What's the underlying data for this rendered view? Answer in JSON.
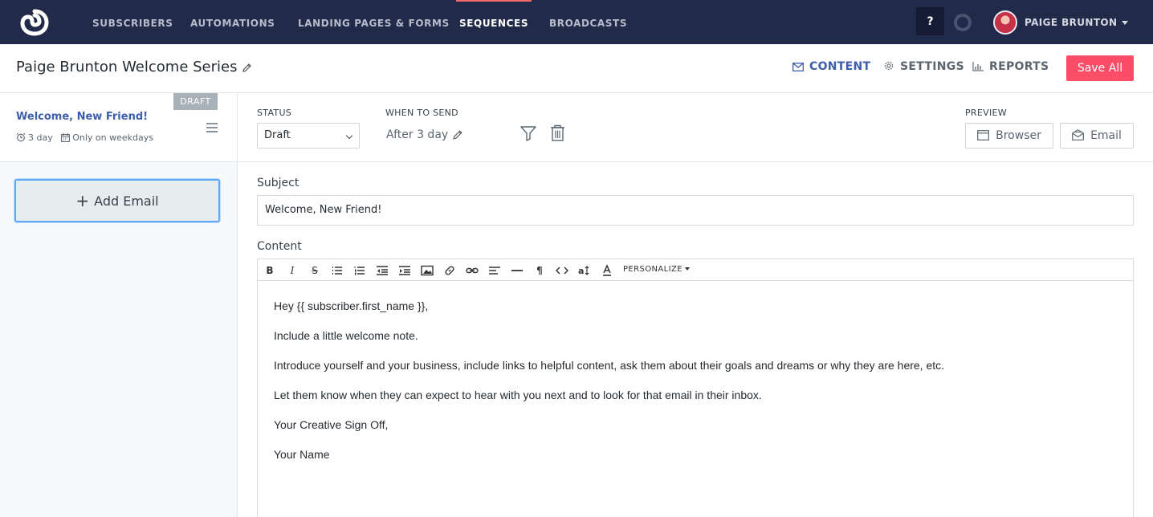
{
  "nav": {
    "items": [
      "SUBSCRIBERS",
      "AUTOMATIONS",
      "LANDING PAGES & FORMS",
      "SEQUENCES",
      "BROADCASTS"
    ],
    "active": "SEQUENCES",
    "help_label": "?",
    "user_name": "PAIGE BRUNTON"
  },
  "header": {
    "title": "Paige Brunton Welcome Series",
    "tabs": {
      "content": "CONTENT",
      "settings": "SETTINGS",
      "reports": "REPORTS"
    },
    "active_tab": "CONTENT",
    "save_label": "Save All"
  },
  "sidebar": {
    "email": {
      "badge": "DRAFT",
      "name": "Welcome, New Friend!",
      "delay": "3 day",
      "schedule": "Only on weekdays"
    },
    "add_email_label": "Add Email"
  },
  "settings": {
    "status_label": "STATUS",
    "status_value": "Draft",
    "when_label": "WHEN TO SEND",
    "when_value": "After 3 day",
    "preview_label": "PREVIEW",
    "preview_browser": "Browser",
    "preview_email": "Email"
  },
  "editor": {
    "subject_label": "Subject",
    "subject_value": "Welcome, New Friend!",
    "content_label": "Content",
    "toolbar": {
      "bold": "B",
      "italic": "I",
      "strike": "S",
      "personalize": "PERSONALIZE"
    },
    "body": [
      "Hey {{ subscriber.first_name }},",
      "Include a little welcome note.",
      "Introduce yourself and your business, include links to helpful content, ask them about their goals and dreams or why they are here, etc.",
      "Let them know when they can expect to hear with you next and to look for that email in their inbox.",
      "Your Creative Sign Off,",
      "Your Name"
    ]
  },
  "colors": {
    "nav_bg": "#222a4a",
    "accent": "#3d5eaa",
    "save_button": "#fb4d68",
    "nav_active_marker": "#fb6970"
  }
}
